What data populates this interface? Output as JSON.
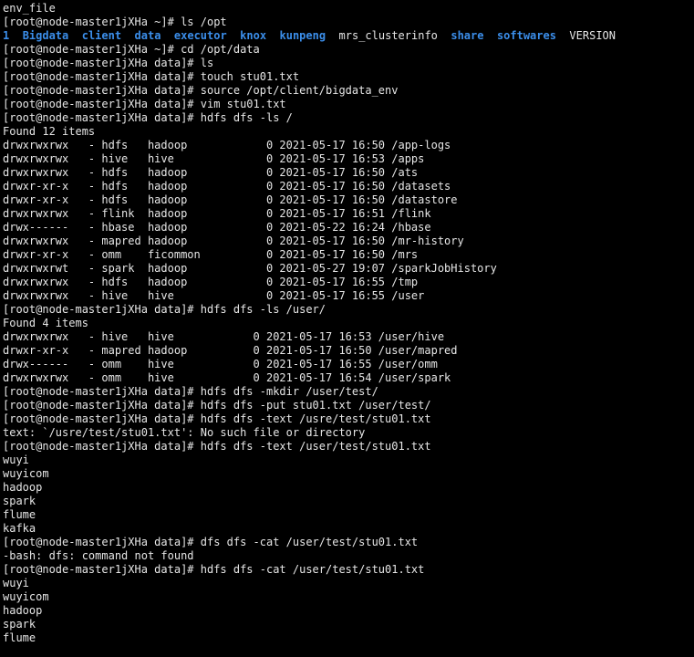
{
  "terminal": {
    "lines": [
      "env_file",
      "[root@node-master1jXHa ~]# ls /opt",
      [
        {
          "t": "1",
          "dir": true
        },
        {
          "t": "  "
        },
        {
          "t": "Bigdata",
          "dir": true
        },
        {
          "t": "  "
        },
        {
          "t": "client",
          "dir": true
        },
        {
          "t": "  "
        },
        {
          "t": "data",
          "dir": true
        },
        {
          "t": "  "
        },
        {
          "t": "executor",
          "dir": true
        },
        {
          "t": "  "
        },
        {
          "t": "knox",
          "dir": true
        },
        {
          "t": "  "
        },
        {
          "t": "kunpeng",
          "dir": true
        },
        {
          "t": "  mrs_clusterinfo  "
        },
        {
          "t": "share",
          "dir": true
        },
        {
          "t": "  "
        },
        {
          "t": "softwares",
          "dir": true
        },
        {
          "t": "  VERSION"
        }
      ],
      "[root@node-master1jXHa ~]# cd /opt/data",
      "[root@node-master1jXHa data]# ls",
      "[root@node-master1jXHa data]# touch stu01.txt",
      "[root@node-master1jXHa data]# source /opt/client/bigdata_env",
      "[root@node-master1jXHa data]# vim stu01.txt",
      "[root@node-master1jXHa data]# hdfs dfs -ls /",
      "Found 12 items",
      "drwxrwxrwx   - hdfs   hadoop            0 2021-05-17 16:50 /app-logs",
      "drwxrwxrwx   - hive   hive              0 2021-05-17 16:53 /apps",
      "drwxrwxrwx   - hdfs   hadoop            0 2021-05-17 16:50 /ats",
      "drwxr-xr-x   - hdfs   hadoop            0 2021-05-17 16:50 /datasets",
      "drwxr-xr-x   - hdfs   hadoop            0 2021-05-17 16:50 /datastore",
      "drwxrwxrwx   - flink  hadoop            0 2021-05-17 16:51 /flink",
      "drwx------   - hbase  hadoop            0 2021-05-22 16:24 /hbase",
      "drwxrwxrwx   - mapred hadoop            0 2021-05-17 16:50 /mr-history",
      "drwxr-xr-x   - omm    ficommon          0 2021-05-17 16:50 /mrs",
      "drwxrwxrwt   - spark  hadoop            0 2021-05-27 19:07 /sparkJobHistory",
      "drwxrwxrwx   - hdfs   hadoop            0 2021-05-17 16:55 /tmp",
      "drwxrwxrwx   - hive   hive              0 2021-05-17 16:55 /user",
      "[root@node-master1jXHa data]# hdfs dfs -ls /user/",
      "Found 4 items",
      "drwxrwxrwx   - hive   hive            0 2021-05-17 16:53 /user/hive",
      "drwxr-xr-x   - mapred hadoop          0 2021-05-17 16:50 /user/mapred",
      "drwx------   - omm    hive            0 2021-05-17 16:55 /user/omm",
      "drwxrwxrwx   - omm    hive            0 2021-05-17 16:54 /user/spark",
      "[root@node-master1jXHa data]# hdfs dfs -mkdir /user/test/",
      "[root@node-master1jXHa data]# hdfs dfs -put stu01.txt /user/test/",
      "[root@node-master1jXHa data]# hdfs dfs -text /usre/test/stu01.txt",
      "text: `/usre/test/stu01.txt': No such file or directory",
      "[root@node-master1jXHa data]# hdfs dfs -text /user/test/stu01.txt",
      "wuyi",
      "wuyicom",
      "hadoop",
      "spark",
      "flume",
      "kafka",
      "[root@node-master1jXHa data]# dfs dfs -cat /user/test/stu01.txt",
      "-bash: dfs: command not found",
      "[root@node-master1jXHa data]# hdfs dfs -cat /user/test/stu01.txt",
      "wuyi",
      "wuyicom",
      "hadoop",
      "spark",
      "flume"
    ]
  },
  "colors": {
    "background": "#000000",
    "text": "#e6e6e6",
    "directory": "#3b8eea"
  }
}
